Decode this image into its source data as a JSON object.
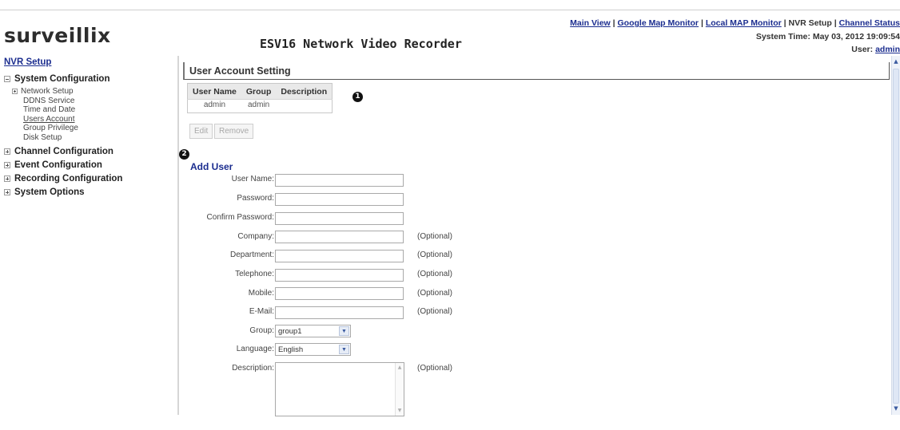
{
  "header": {
    "logo_text": "surveillix",
    "product_title": "ESV16 Network Video Recorder",
    "nav": {
      "main_view": "Main View",
      "google_map": "Google Map Monitor",
      "local_map": "Local MAP Monitor",
      "nvr_setup": "NVR Setup",
      "channel_status": "Channel Status",
      "separator": "|"
    },
    "system_time_label": "System Time:",
    "system_time": "May 03, 2012 19:09:54",
    "user_label": "User:",
    "user_name": "admin"
  },
  "sidebar": {
    "title": "NVR Setup",
    "system_configuration": {
      "label": "System Configuration",
      "items": {
        "network_setup": "Network Setup",
        "ddns": "DDNS Service",
        "time_date": "Time and Date",
        "users_account": "Users Account",
        "group_privilege": "Group Privilege",
        "disk_setup": "Disk Setup"
      }
    },
    "channel_configuration": "Channel Configuration",
    "event_configuration": "Event Configuration",
    "recording_configuration": "Recording Configuration",
    "system_options": "System Options"
  },
  "main": {
    "section_title": "User Account Setting",
    "table": {
      "headers": [
        "User Name",
        "Group",
        "Description"
      ],
      "rows": [
        [
          "admin",
          "admin",
          ""
        ]
      ]
    },
    "markers": [
      "1",
      "2"
    ],
    "edit_button": "Edit",
    "remove_button": "Remove",
    "add_user_title": "Add User",
    "form": {
      "user_name": "User Name:",
      "password": "Password:",
      "confirm_password": "Confirm Password:",
      "company": "Company:",
      "department": "Department:",
      "telephone": "Telephone:",
      "mobile": "Mobile:",
      "email": "E-Mail:",
      "group": "Group:",
      "language": "Language:",
      "description": "Description:",
      "optional": "(Optional)",
      "group_value": "group1",
      "language_value": "English"
    }
  },
  "icons": {
    "collapse": "minus-box-icon",
    "expand": "plus-box-icon",
    "dropdown": "chevron-down-icon"
  }
}
